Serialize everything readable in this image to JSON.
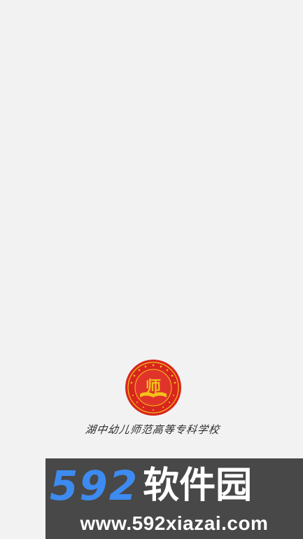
{
  "splash": {
    "logo_icon": "school-emblem-icon",
    "logo_text": "师",
    "school_name": "湖中幼儿师范高等专科学校"
  },
  "watermark": {
    "number": "592",
    "chinese": "软件园",
    "url": "www.592xiazai.com",
    "colors": {
      "number": "#3d8bf0",
      "text": "#ffffff",
      "background": "#484848"
    }
  },
  "colors": {
    "background": "#f2f2f2",
    "emblem_red": "#d8261e",
    "emblem_gold": "#f3c21a"
  }
}
